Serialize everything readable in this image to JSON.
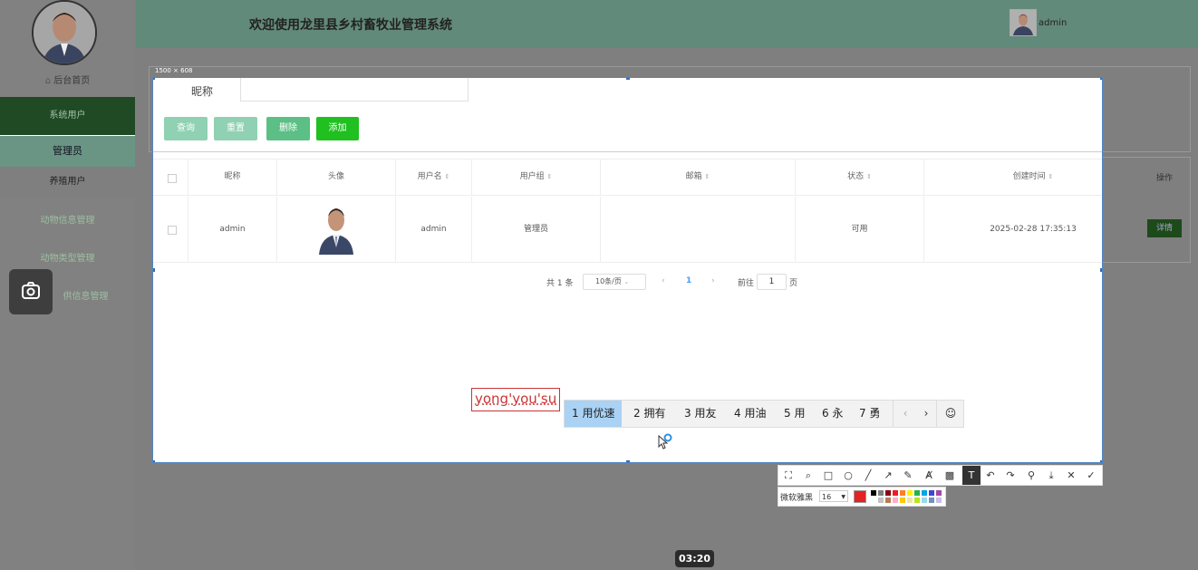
{
  "header": {
    "title": "欢迎使用龙里县乡村畜牧业管理系统",
    "user": "admin"
  },
  "sidebar": {
    "home": "后台首页",
    "items": [
      "系统用户",
      "管理员",
      "养殖用户",
      "动物信息管理",
      "动物类型管理",
      "供信息管理"
    ]
  },
  "capture": {
    "size_label": "1500 × 608"
  },
  "search": {
    "label": "昵称",
    "value": ""
  },
  "buttons": {
    "query": "查询",
    "reset": "重置",
    "delete": "删除",
    "add": "添加"
  },
  "colors": {
    "query": "#8fd1b2",
    "reset": "#8fd1b2",
    "delete": "#5cbf85",
    "add": "#1fc01f",
    "header": "#628a7b",
    "detail": "#1d4a1a"
  },
  "table": {
    "headers": [
      "昵称",
      "头像",
      "用户名",
      "用户组",
      "邮箱",
      "状态",
      "创建时间",
      "操作"
    ],
    "rows": [
      {
        "nickname": "admin",
        "username": "admin",
        "group": "管理员",
        "email": "",
        "status": "可用",
        "created": "2025-02-28 17:35:13",
        "action": "详情"
      }
    ]
  },
  "pagination": {
    "total": "共 1 条",
    "page_size": "10条/页",
    "current": "1",
    "goto": "前往",
    "goto_value": "1",
    "page_unit": "页"
  },
  "ime": {
    "composition": "yong'you'su",
    "candidates": [
      "1 用优速",
      "2 拥有",
      "3 用友",
      "4 用油",
      "5 用",
      "6 永",
      "7 勇"
    ]
  },
  "screenshot_toolbar": {
    "tools": [
      "screen-capture-icon",
      "magnifier-icon",
      "rectangle-icon",
      "ellipse-icon",
      "line-icon",
      "arrow-icon",
      "pen-icon",
      "marker-icon",
      "mosaic-icon",
      "text-icon",
      "undo-icon",
      "redo-icon",
      "pin-icon",
      "download-icon",
      "close-icon",
      "check-icon"
    ],
    "font_name": "微软雅黑",
    "font_size": "16",
    "current_color": "#e52222",
    "swatches": [
      "#000000",
      "#7f7f7f",
      "#880015",
      "#ed1c24",
      "#ff7f27",
      "#fff200",
      "#22b14c",
      "#00a2e8",
      "#3f48cc",
      "#a349a4",
      "#ffffff",
      "#c3c3c3",
      "#b97a57",
      "#ffaec9",
      "#ffc90e",
      "#efe4b0",
      "#b5e61d",
      "#99d9ea",
      "#7092be",
      "#c8bfe7"
    ]
  },
  "video": {
    "timestamp": "03:20"
  }
}
